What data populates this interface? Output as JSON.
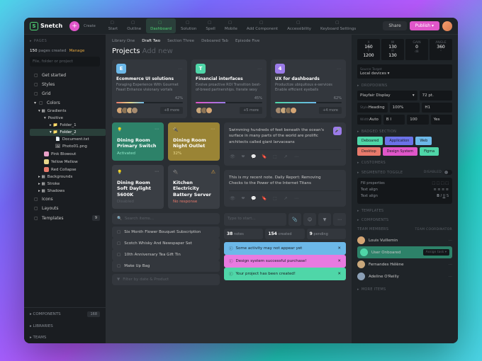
{
  "brand": "Snetch",
  "topbar": {
    "create": "Create",
    "tabs": [
      {
        "label": "Start"
      },
      {
        "label": "Outline"
      },
      {
        "label": "Dashboard"
      },
      {
        "label": "Solution"
      },
      {
        "label": "Spell"
      },
      {
        "label": "Mobile"
      },
      {
        "label": "Add Component"
      },
      {
        "label": "Accessibility"
      },
      {
        "label": "Keyboard Settings"
      }
    ],
    "share": "Share",
    "publish": "Publish ▾"
  },
  "sidebar": {
    "pages_label": "PAGES",
    "count": "150",
    "count_label": "pages created",
    "manage": "Manage",
    "search_ph": "File, folder or project",
    "items": [
      {
        "label": "Get started"
      },
      {
        "label": "Styles"
      },
      {
        "label": "Grid"
      },
      {
        "label": "Colors"
      }
    ],
    "tree": {
      "gradients": "Gradients",
      "positive": "Positive",
      "folder1": "Folder_1",
      "folder2": "Folder_2",
      "document": "Document.txt",
      "photo": "Photo01.png",
      "swatches": [
        {
          "label": "Pink Blowout",
          "color": "#e8a0c8"
        },
        {
          "label": "Yellow Mellow",
          "color": "#e8d88c"
        },
        {
          "label": "Red Collapse",
          "color": "#e87a6c"
        }
      ],
      "rest": [
        "Backgrounds",
        "Stroke",
        "Shadows"
      ]
    },
    "more": [
      {
        "label": "Icons"
      },
      {
        "label": "Layouts"
      },
      {
        "label": "Templates",
        "badge": "9"
      }
    ],
    "bottom": [
      {
        "label": "COMPONENTS",
        "badge": "168"
      },
      {
        "label": "LIBRARIES"
      },
      {
        "label": "TEAMS"
      }
    ]
  },
  "breadcrumb": [
    "Library One",
    "Draft Two",
    "Section Three",
    "Deboared Tab",
    "Episode Five"
  ],
  "page_title": "Projects",
  "page_add": "Add new",
  "projects": [
    {
      "badge": "E",
      "badge_bg": "#6cb8e8",
      "title": "Ecommerce UI solutions",
      "desc": "Foraging Experience With Gourmet Feast Enhance visionary vortals",
      "pct": "42%",
      "bar": 42,
      "bar_color": "linear-gradient(90deg,#e87a6c,#e8d88c,#6cb8e8)",
      "more": "+8 more",
      "avatars": [
        "#d4a574",
        "#8b7355",
        "#c9a87c",
        "#a68b6f"
      ]
    },
    {
      "badge": "T",
      "badge_bg": "#4fd6a8",
      "title": "Financial interfaces",
      "desc": "Evolve proactive ROI Transition best-of-breed partnerships. Iterate sexy initiatives",
      "pct": "45%",
      "bar": 45,
      "bar_color": "linear-gradient(90deg,#e056c9,#9b7be8)",
      "more": "+5 more",
      "avatars": [
        "#c9a87c",
        "#8b7355",
        "#d4a574"
      ]
    },
    {
      "badge": "4",
      "badge_bg": "#9b7be8",
      "title": "UX for dashboards",
      "desc": "Productize ubiquitous e-services Enable efficient eyeballs",
      "pct": "62%",
      "bar": 62,
      "bar_color": "linear-gradient(90deg,#4fd6a8,#6cb8e8)",
      "more": "+4 more",
      "avatars": [
        "#a68b6f",
        "#c9a87c",
        "#8b7355",
        "#d4a574"
      ]
    }
  ],
  "devices": [
    {
      "bg": "#2d8269",
      "title": "Dining Room Primary Switch",
      "status": "Activated",
      "status_color": "#8fe8c8"
    },
    {
      "bg": "#9a8435",
      "title": "Dining Room Night Outlet",
      "status": "32%",
      "status_color": "#e8d88c"
    },
    {
      "bg": "#3a3e44",
      "title": "Dining Room Soft Daylight 5600K",
      "status": "Disabled",
      "status_color": "#5a5f66",
      "warn": false
    },
    {
      "bg": "#3a3e44",
      "title": "Kitchen Electricity Battery Server",
      "status": "No response",
      "status_color": "#e87a6c",
      "warn": true
    }
  ],
  "notes": [
    "Swimming hundreds of feet beneath the ocean's surface in many parts of the world are prolific architects called giant larvaceans",
    "This is my recent note. Daily Report: Removing Checks to the Power of the Internet Titans"
  ],
  "search": {
    "ph": "Search items...",
    "items": [
      "Six Month Flower Bouquet Subscription",
      "Scotch Whisky And Newspaper Set",
      "10th Anniversary Tea Gift Tin",
      "Make Up Bag"
    ],
    "filter": "Filter by date & Product"
  },
  "typebar": "Type to start...",
  "stats": [
    {
      "n": "38",
      "l": "notes"
    },
    {
      "n": "154",
      "l": "created"
    },
    {
      "n": "9",
      "l": "pending"
    }
  ],
  "toasts": [
    {
      "text": "Some activity may not appear yet",
      "bg": "#6cb8e8"
    },
    {
      "text": "Design system successful purchase!",
      "bg": "#e87ae0"
    },
    {
      "text": "Your project has been created!",
      "bg": "#4fd6a8"
    }
  ],
  "rpanel": {
    "src_label": "Source Target",
    "src_val": "Local devices ▾",
    "grid": [
      {
        "lbl": "X",
        "val": "160",
        "lbl2": "Y",
        "val2": "1200"
      },
      {
        "lbl": "W",
        "val": "130",
        "lbl2": "H",
        "val2": "130"
      },
      {
        "lbl": "GAIN",
        "val": "0",
        "unit": "dB"
      },
      {
        "lbl": "ANGLE",
        "val": "360",
        "unit": "°"
      }
    ],
    "dropdowns": "DROPDOWNS",
    "font": "Playfair Display",
    "size": "72 pt.",
    "style": "Heading",
    "pct": "100%",
    "lh": "H1",
    "width_lbl": "Width",
    "width_val": "Auto",
    "weight": "B I",
    "tracked": "Tracked",
    "tracked_val": "100",
    "yes": "Yes",
    "badged": "BADGED SECTION",
    "chips": [
      {
        "t": "Deboared",
        "c": "#4fd6a8"
      },
      {
        "t": "Application",
        "c": "#6b72e8"
      },
      {
        "t": "Web",
        "c": "#6cb8e8"
      },
      {
        "t": "Desktop",
        "c": "#e87a6c"
      },
      {
        "t": "Design System",
        "c": "#e056c9"
      },
      {
        "t": "Figma",
        "c": "#4fd6a8"
      }
    ],
    "customers": "CUSTOMERS",
    "segmented": "SEGMENTED TOGGLE",
    "disabled": "Disabled",
    "fill": "Fill properties",
    "align": "Text align",
    "align2": "Text align",
    "templates": "TEMPLATES",
    "components": "COMPONENTS",
    "team": "TEAM MEMBERS",
    "team_coord": "Team coordinator",
    "members": [
      {
        "n": "Louis Vuillemin",
        "c": "#d4a574",
        "role": ""
      },
      {
        "n": "User Onboared",
        "c": "#4fd6a8",
        "role": "Assign task ▾",
        "hl": true
      },
      {
        "n": "Fernandes Hélène",
        "c": "#c9a87c",
        "role": ""
      },
      {
        "n": "Adeline O'Reilly",
        "c": "#8b9fb5",
        "role": ""
      }
    ],
    "more": "MORE ITEMS"
  }
}
